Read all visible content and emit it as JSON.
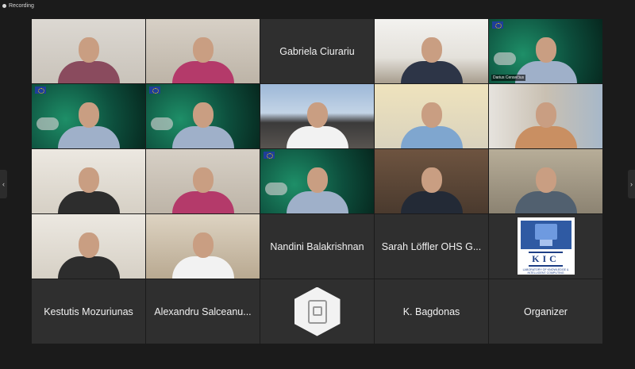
{
  "header": {
    "recording_label": "Recording"
  },
  "nav": {
    "prev_arrow": "‹",
    "next_arrow": "›"
  },
  "gallery": {
    "active_speaker_tag": "Darius Ceravičius",
    "tiles": [
      {
        "type": "video",
        "scene": "office"
      },
      {
        "type": "video",
        "scene": "room"
      },
      {
        "type": "name",
        "name": "Gabriela Ciurariu"
      },
      {
        "type": "video",
        "scene": "ceiling"
      },
      {
        "type": "video",
        "scene": "green",
        "active": true
      },
      {
        "type": "video",
        "scene": "green"
      },
      {
        "type": "video",
        "scene": "green"
      },
      {
        "type": "video",
        "scene": "building"
      },
      {
        "type": "video",
        "scene": "pale"
      },
      {
        "type": "video",
        "scene": "window"
      },
      {
        "type": "video",
        "scene": "wall"
      },
      {
        "type": "video",
        "scene": "room"
      },
      {
        "type": "video",
        "scene": "green"
      },
      {
        "type": "video",
        "scene": "books"
      },
      {
        "type": "video",
        "scene": "photos"
      },
      {
        "type": "video",
        "scene": "wall"
      },
      {
        "type": "video",
        "scene": "dark"
      },
      {
        "type": "name",
        "name": "Nandini Balakrishnan"
      },
      {
        "type": "name",
        "name": "Sarah Löffler OHS G..."
      },
      {
        "type": "logo",
        "logo": {
          "title": "KIC",
          "subtitle": "LABORATORY OF KNOWLEDGE & INTELLIGENT COMPUTING"
        }
      },
      {
        "type": "name",
        "name": "Kestutis Mozuriunas"
      },
      {
        "type": "name",
        "name": "Alexandru Salceanu..."
      },
      {
        "type": "avatar"
      },
      {
        "type": "name",
        "name": "K. Bagdonas"
      },
      {
        "type": "name",
        "name": "Organizer"
      }
    ]
  },
  "colors": {
    "background": "#1b1b1b",
    "tile": "#2f2f2f",
    "active_border": "#f0d66b",
    "text": "#f1f1f1"
  }
}
